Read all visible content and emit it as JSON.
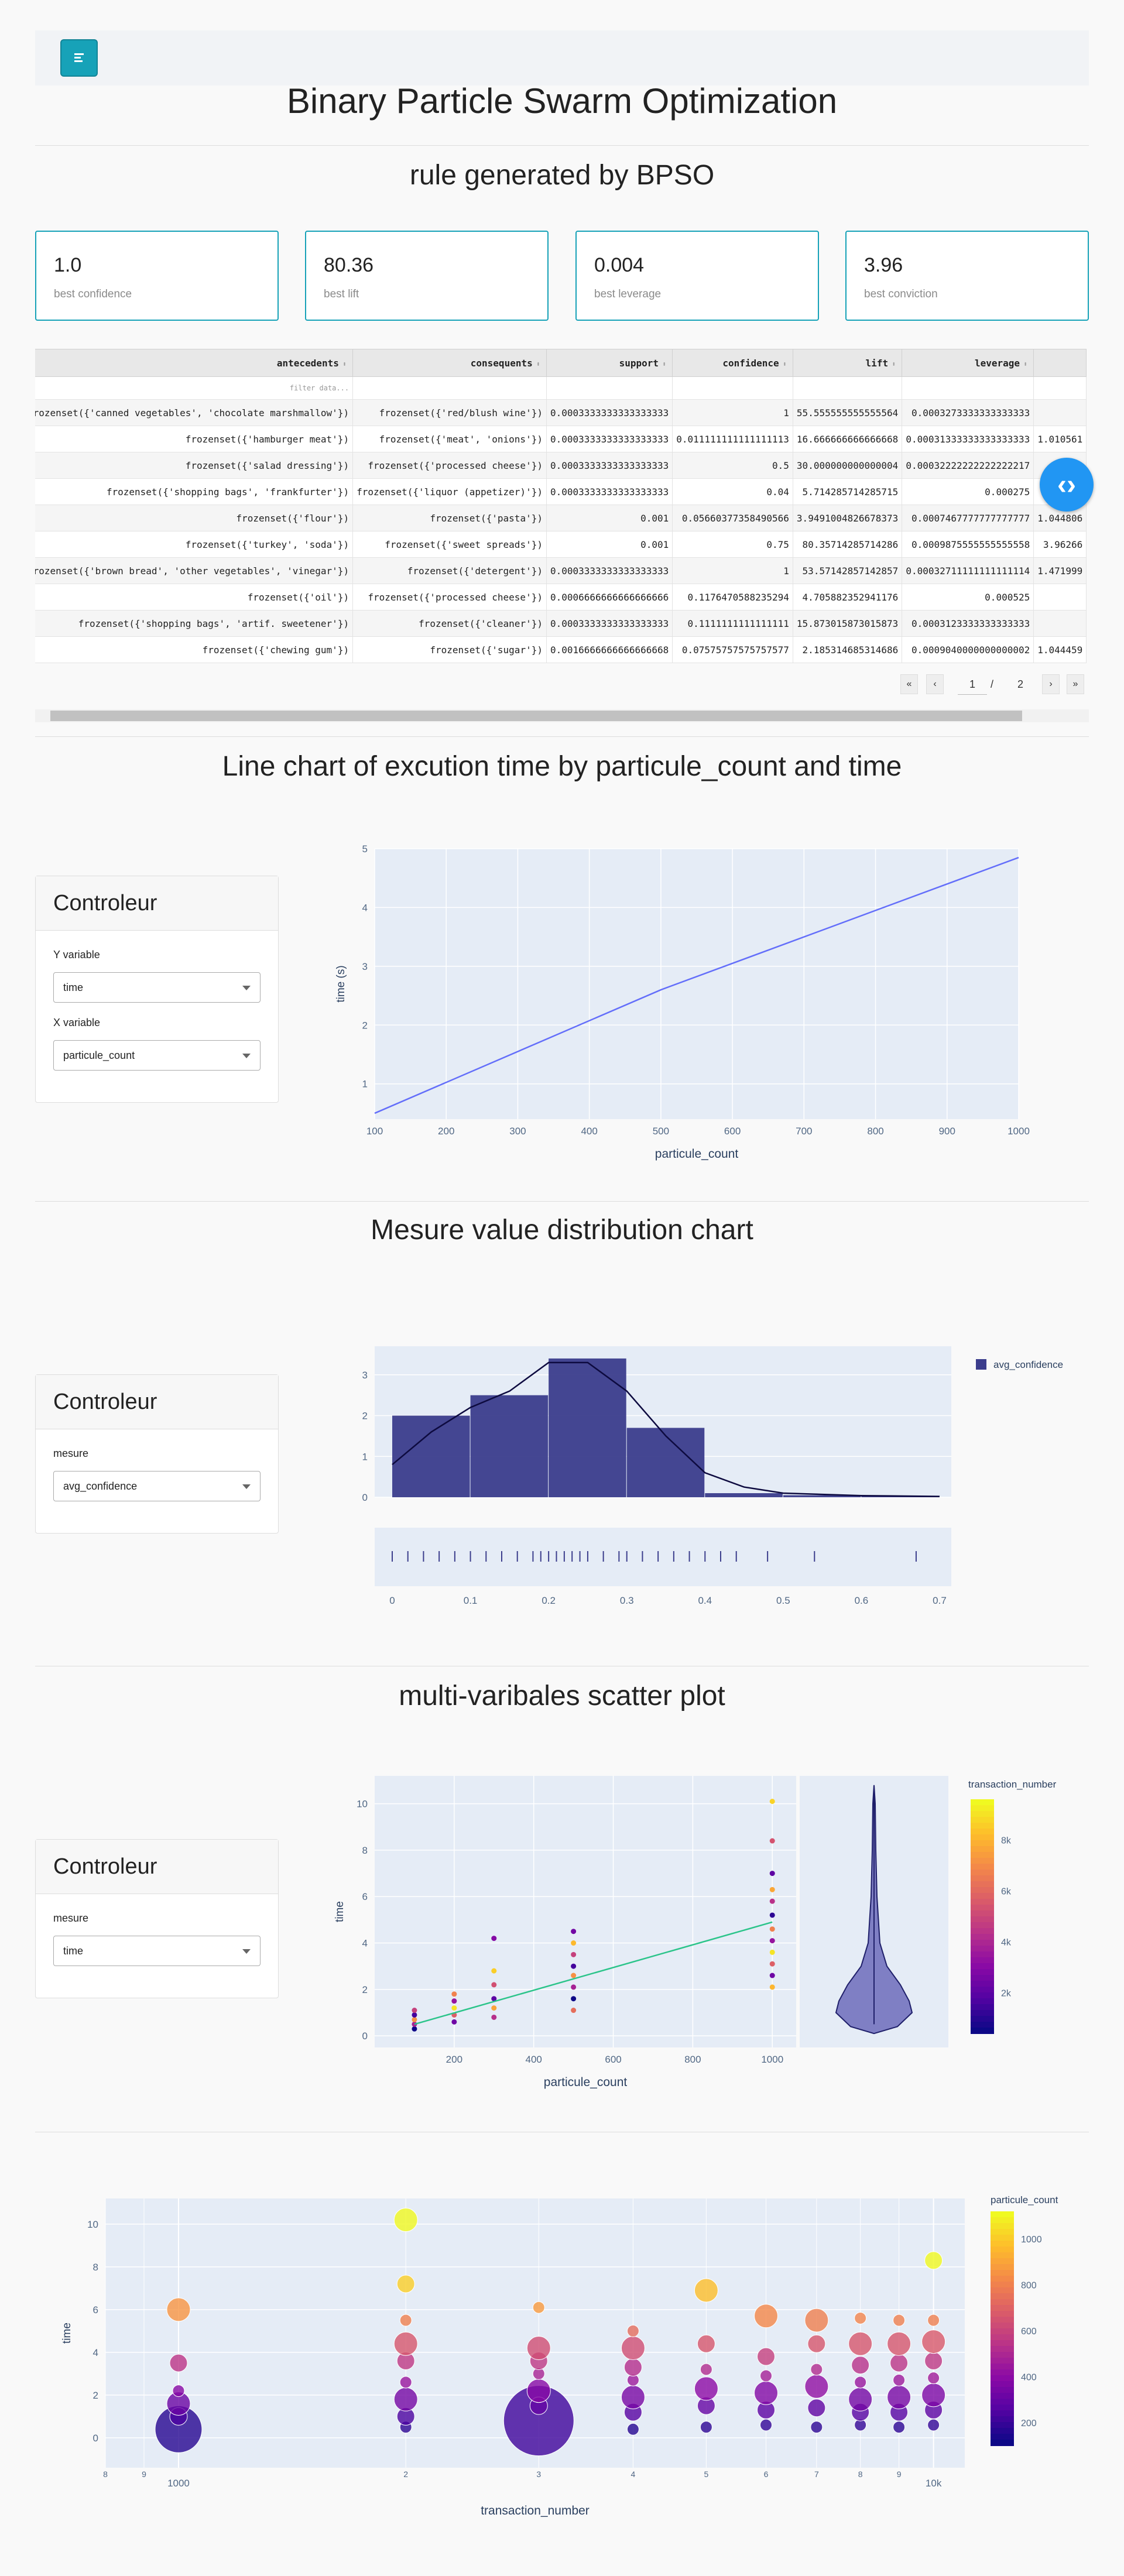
{
  "title": "Binary Particle Swarm Optimization",
  "rules_section": {
    "heading": "rule generated by BPSO",
    "cards": [
      {
        "value": "1.0",
        "label": "best confidence"
      },
      {
        "value": "80.36",
        "label": "best lift"
      },
      {
        "value": "0.004",
        "label": "best leverage"
      },
      {
        "value": "3.96",
        "label": "best conviction"
      }
    ],
    "table": {
      "columns": [
        "antecedents",
        "consequents",
        "support",
        "confidence",
        "lift",
        "leverage"
      ],
      "filter_placeholder": "filter data...",
      "rows": [
        [
          "frozenset({'canned vegetables', 'chocolate marshmallow'})",
          "frozenset({'red/blush wine'})",
          "0.0003333333333333333",
          "1",
          "55.555555555555564",
          "0.0003273333333333333",
          ""
        ],
        [
          "frozenset({'hamburger meat'})",
          "frozenset({'meat', 'onions'})",
          "0.0003333333333333333",
          "0.011111111111111113",
          "16.666666666666668",
          "0.00031333333333333333",
          "1.010561"
        ],
        [
          "frozenset({'salad dressing'})",
          "frozenset({'processed cheese'})",
          "0.0003333333333333333",
          "0.5",
          "30.000000000000004",
          "0.00032222222222222217",
          ""
        ],
        [
          "frozenset({'shopping bags', 'frankfurter'})",
          "frozenset({'liquor (appetizer)'})",
          "0.0003333333333333333",
          "0.04",
          "5.714285714285715",
          "0.000275",
          ""
        ],
        [
          "frozenset({'flour'})",
          "frozenset({'pasta'})",
          "0.001",
          "0.05660377358490566",
          "3.9491004826678373",
          "0.0007467777777777777",
          "1.044806"
        ],
        [
          "frozenset({'turkey', 'soda'})",
          "frozenset({'sweet spreads'})",
          "0.001",
          "0.75",
          "80.35714285714286",
          "0.0009875555555555558",
          "3.96266"
        ],
        [
          "frozenset({'brown bread', 'other vegetables', 'vinegar'})",
          "frozenset({'detergent'})",
          "0.0003333333333333333",
          "1",
          "53.57142857142857",
          "0.00032711111111111114",
          "1.471999"
        ],
        [
          "frozenset({'oil'})",
          "frozenset({'processed cheese'})",
          "0.0006666666666666666",
          "0.1176470588235294",
          "4.705882352941176",
          "0.000525",
          ""
        ],
        [
          "frozenset({'shopping bags', 'artif. sweetener'})",
          "frozenset({'cleaner'})",
          "0.0003333333333333333",
          "0.1111111111111111",
          "15.873015873015873",
          "0.0003123333333333333",
          ""
        ],
        [
          "frozenset({'chewing gum'})",
          "frozenset({'sugar'})",
          "0.0016666666666666668",
          "0.07575757575757577",
          "2.185314685314686",
          "0.0009040000000000002",
          "1.044459"
        ]
      ]
    },
    "pagination": {
      "current": "1",
      "separator": "/",
      "total": "2"
    }
  },
  "line_section": {
    "heading": "Line chart of excution time by particule_count and time",
    "controller": {
      "title": "Controleur",
      "y_label": "Y variable",
      "y_value": "time",
      "x_label": "X variable",
      "x_value": "particule_count"
    }
  },
  "dist_section": {
    "heading": "Mesure value distribution chart",
    "controller": {
      "title": "Controleur",
      "label": "mesure",
      "value": "avg_confidence"
    }
  },
  "scatter_section": {
    "heading": "multi-varibales scatter plot",
    "controller": {
      "title": "Controleur",
      "label": "mesure",
      "value": "time"
    }
  },
  "colors": {
    "accent": "#17a2b8",
    "plot_bg": "#e5ecf6",
    "line": "#636efa",
    "hist": "#3b3d8c",
    "trend": "#2bc48a",
    "fab": "#2196f3"
  },
  "chart_data": [
    {
      "type": "line",
      "title": "",
      "xlabel": "particule_count",
      "ylabel": "time (s)",
      "x": [
        100,
        500,
        1000
      ],
      "y": [
        0.5,
        2.6,
        4.85
      ],
      "xlim": [
        100,
        1000
      ],
      "ylim": [
        0.4,
        5
      ],
      "xticks": [
        100,
        200,
        300,
        400,
        500,
        600,
        700,
        800,
        900,
        1000
      ],
      "yticks": [
        1,
        2,
        3,
        4,
        5
      ],
      "grid": true
    },
    {
      "type": "bar",
      "title": "",
      "series_name": "avg_confidence",
      "legend": "top-right",
      "bin_edges": [
        0,
        0.1,
        0.2,
        0.3,
        0.4,
        0.5,
        0.6,
        0.7
      ],
      "values": [
        2.0,
        2.5,
        3.4,
        1.7,
        0.1,
        0.05,
        0.03
      ],
      "kde": [
        [
          0,
          0.8
        ],
        [
          0.05,
          1.6
        ],
        [
          0.1,
          2.2
        ],
        [
          0.15,
          2.6
        ],
        [
          0.2,
          3.3
        ],
        [
          0.25,
          3.3
        ],
        [
          0.3,
          2.6
        ],
        [
          0.35,
          1.5
        ],
        [
          0.4,
          0.6
        ],
        [
          0.45,
          0.25
        ],
        [
          0.5,
          0.1
        ],
        [
          0.6,
          0.04
        ],
        [
          0.7,
          0.02
        ]
      ],
      "ylim": [
        0,
        3.7
      ],
      "xticks": [
        0,
        0.1,
        0.2,
        0.3,
        0.4,
        0.5,
        0.6,
        0.7
      ],
      "yticks": [
        0,
        1,
        2,
        3
      ],
      "rug": [
        0,
        0.02,
        0.04,
        0.06,
        0.08,
        0.1,
        0.12,
        0.14,
        0.16,
        0.18,
        0.19,
        0.2,
        0.21,
        0.22,
        0.23,
        0.24,
        0.25,
        0.27,
        0.29,
        0.3,
        0.32,
        0.34,
        0.36,
        0.38,
        0.4,
        0.42,
        0.44,
        0.48,
        0.54,
        0.67
      ]
    },
    {
      "type": "scatter",
      "title": "",
      "xlabel": "particule_count",
      "ylabel": "time",
      "colorbar": "transaction_number",
      "colorbar_ticks": [
        "2k",
        "4k",
        "6k",
        "8k"
      ],
      "xticks": [
        200,
        400,
        600,
        800,
        1000
      ],
      "yticks": [
        0,
        2,
        4,
        6,
        8,
        10
      ],
      "xlim": [
        0,
        1060
      ],
      "ylim": [
        -0.5,
        11.2
      ],
      "trend": [
        [
          100,
          0.5
        ],
        [
          1000,
          4.9
        ]
      ],
      "points": [
        {
          "x": 100,
          "y": [
            0.3,
            0.5,
            0.7,
            0.9,
            1.1
          ]
        },
        {
          "x": 200,
          "y": [
            0.6,
            0.9,
            1.2,
            1.5,
            1.8
          ]
        },
        {
          "x": 300,
          "y": [
            0.8,
            1.2,
            1.6,
            2.2,
            2.8,
            4.2
          ]
        },
        {
          "x": 500,
          "y": [
            1.1,
            1.6,
            2.1,
            2.6,
            3.0,
            3.5,
            4.0,
            4.5
          ]
        },
        {
          "x": 1000,
          "y": [
            2.1,
            2.6,
            3.1,
            3.6,
            4.1,
            4.6,
            5.2,
            5.8,
            6.3,
            7.0,
            8.4,
            10.1
          ]
        }
      ]
    },
    {
      "type": "scatter",
      "title": "",
      "xlabel": "transaction_number",
      "ylabel": "time",
      "colorbar": "particule_count",
      "colorbar_ticks": [
        "200",
        "400",
        "600",
        "800",
        "1000"
      ],
      "x_scale": "log",
      "xticks": [
        "8",
        "9",
        "1000",
        "2",
        "3",
        "4",
        "5",
        "6",
        "7",
        "8",
        "9",
        "10k"
      ],
      "yticks": [
        0,
        2,
        4,
        6,
        8,
        10
      ],
      "ylim": [
        -1.4,
        11.2
      ],
      "points": [
        {
          "x": 1000,
          "y": [
            0.4,
            1.0,
            1.6,
            2.2,
            3.5,
            6.0
          ]
        },
        {
          "x": 2000,
          "y": [
            0.5,
            1.0,
            1.8,
            2.6,
            3.6,
            4.4,
            5.5,
            7.2,
            10.2
          ]
        },
        {
          "x": 3000,
          "y": [
            0.8,
            1.5,
            2.2,
            3.0,
            3.6,
            4.2,
            6.1
          ]
        },
        {
          "x": 4000,
          "y": [
            0.4,
            1.2,
            1.9,
            2.7,
            3.3,
            4.2,
            5.0
          ]
        },
        {
          "x": 5000,
          "y": [
            0.5,
            1.5,
            2.3,
            3.2,
            4.4,
            6.9
          ]
        },
        {
          "x": 6000,
          "y": [
            0.6,
            1.3,
            2.1,
            2.9,
            3.8,
            5.7
          ]
        },
        {
          "x": 7000,
          "y": [
            0.5,
            1.4,
            2.4,
            3.2,
            4.4,
            5.5
          ]
        },
        {
          "x": 8000,
          "y": [
            0.6,
            1.2,
            1.8,
            2.6,
            3.4,
            4.4,
            5.6
          ]
        },
        {
          "x": 9000,
          "y": [
            0.5,
            1.2,
            1.9,
            2.7,
            3.5,
            4.4,
            5.5
          ]
        },
        {
          "x": 10000,
          "y": [
            0.6,
            1.3,
            2.0,
            2.8,
            3.6,
            4.5,
            5.5,
            8.3
          ]
        }
      ]
    }
  ]
}
